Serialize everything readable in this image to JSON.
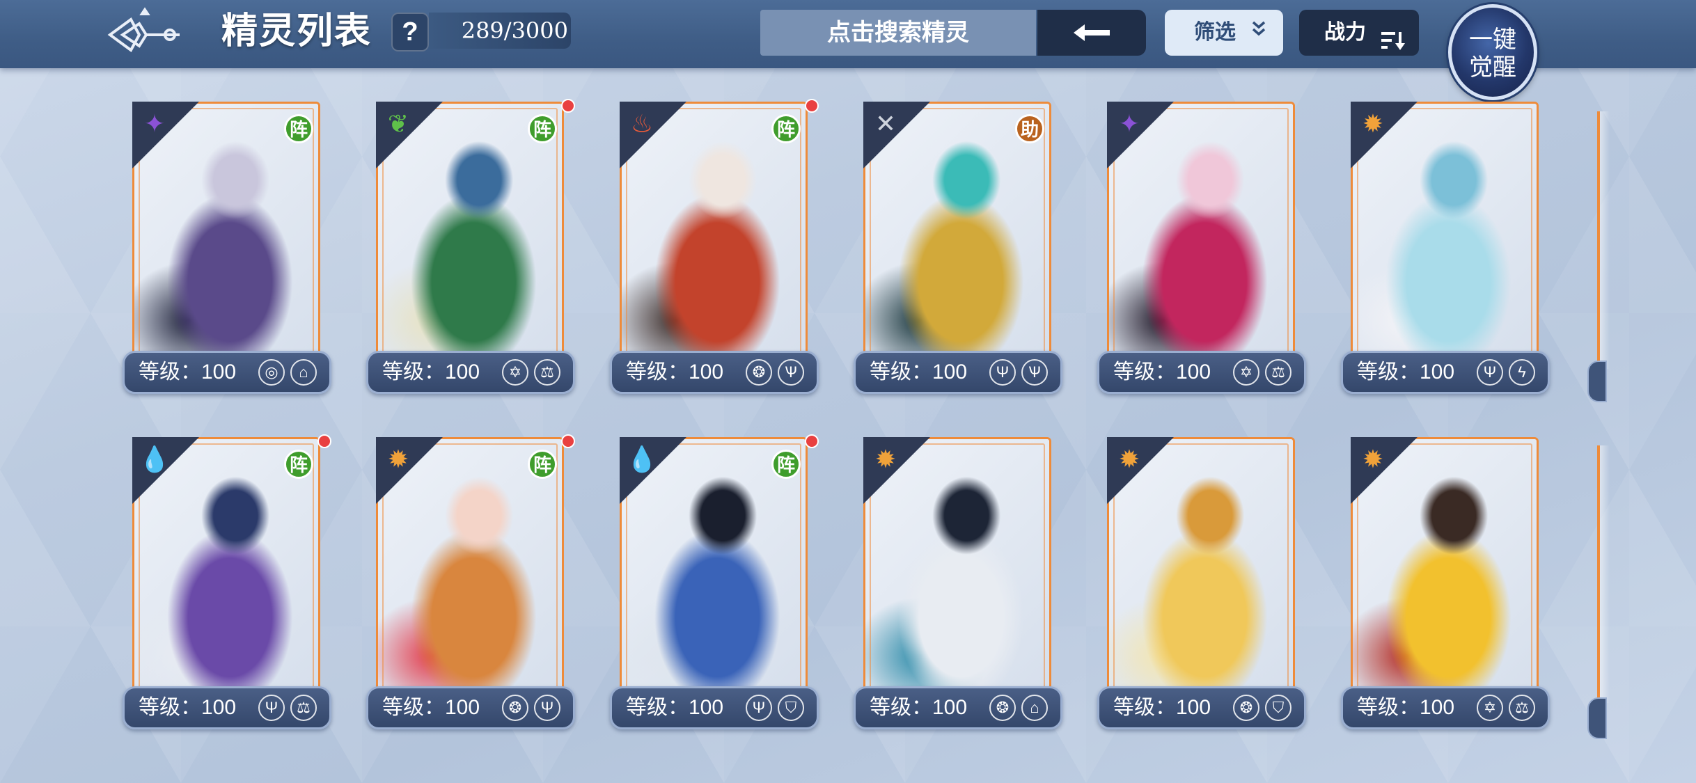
{
  "header": {
    "title": "精灵列表",
    "help": "?",
    "count": "289/3000",
    "search_placeholder": "点击搜索精灵",
    "search_back": "⟵",
    "filter_label": "筛选",
    "sort_label": "战力",
    "awaken_line1": "一键",
    "awaken_line2": "觉醒"
  },
  "colors": {
    "topbar": "#3f5d86",
    "card_border": "#ee8b3a",
    "badge_green": "#3f9d2c",
    "badge_orange": "#b9621e",
    "notify_red": "#e94040"
  },
  "cards": [
    {
      "element": "dark",
      "element_icon": "✦",
      "element_color": "#8b52d6",
      "badge": "阵",
      "badge_type": "green",
      "new": false,
      "level": "等级：100",
      "skills": [
        "swirl",
        "book"
      ],
      "art": [
        "#5a4a8a",
        "#1c1f38",
        "#c9c6dc"
      ]
    },
    {
      "element": "grass",
      "element_icon": "❦",
      "element_color": "#5fc04a",
      "badge": "阵",
      "badge_type": "green",
      "new": true,
      "level": "等级：100",
      "skills": [
        "star",
        "scale"
      ],
      "art": [
        "#2f7a4a",
        "#e8e3c2",
        "#3b6c9c"
      ]
    },
    {
      "element": "fire",
      "element_icon": "♨",
      "element_color": "#e55a3a",
      "badge": "阵",
      "badge_type": "green",
      "new": true,
      "level": "等级：100",
      "skills": [
        "dragon",
        "claw"
      ],
      "art": [
        "#c3432c",
        "#3a2a26",
        "#efe6e0"
      ]
    },
    {
      "element": "neutral",
      "element_icon": "✕",
      "element_color": "#cfd4dd",
      "badge": "助",
      "badge_type": "orange",
      "new": false,
      "level": "等级：100",
      "skills": [
        "trident",
        "claw"
      ],
      "art": [
        "#d2a93a",
        "#17343a",
        "#3bbbb7"
      ]
    },
    {
      "element": "dark",
      "element_icon": "✦",
      "element_color": "#8b52d6",
      "badge": "",
      "badge_type": "",
      "new": false,
      "level": "等级：100",
      "skills": [
        "star",
        "scale"
      ],
      "art": [
        "#c2265e",
        "#1c1424",
        "#f0c7d9"
      ]
    },
    {
      "element": "light",
      "element_icon": "✹",
      "element_color": "#f0a23a",
      "badge": "",
      "badge_type": "",
      "new": false,
      "level": "等级：100",
      "skills": [
        "trident",
        "bolt"
      ],
      "art": [
        "#a9dcea",
        "#f3f3f7",
        "#7cc0d8"
      ]
    },
    {
      "element": "water",
      "element_icon": "💧",
      "element_color": "#3a8de5",
      "badge": "阵",
      "badge_type": "green",
      "new": true,
      "level": "等级：100",
      "skills": [
        "trident",
        "scale"
      ],
      "art": [
        "#6a4aa8",
        "#e8ebf2",
        "#2b3a6a"
      ]
    },
    {
      "element": "light",
      "element_icon": "✹",
      "element_color": "#f0a23a",
      "badge": "阵",
      "badge_type": "green",
      "new": true,
      "level": "等级：100",
      "skills": [
        "dragon",
        "trident"
      ],
      "art": [
        "#d9863e",
        "#e23a4a",
        "#f4d4c8"
      ]
    },
    {
      "element": "water",
      "element_icon": "💧",
      "element_color": "#3a8de5",
      "badge": "阵",
      "badge_type": "green",
      "new": true,
      "level": "等级：100",
      "skills": [
        "trident",
        "shield"
      ],
      "art": [
        "#3a63b8",
        "#dfe6ee",
        "#1a1f2e"
      ]
    },
    {
      "element": "light",
      "element_icon": "✹",
      "element_color": "#f0a23a",
      "badge": "",
      "badge_type": "",
      "new": false,
      "level": "等级：100",
      "skills": [
        "dragon",
        "book"
      ],
      "art": [
        "#e8ecf2",
        "#2a8aa8",
        "#1d2536"
      ]
    },
    {
      "element": "light",
      "element_icon": "✹",
      "element_color": "#f0a23a",
      "badge": "",
      "badge_type": "",
      "new": false,
      "level": "等级：100",
      "skills": [
        "dragon",
        "shield"
      ],
      "art": [
        "#f0c85a",
        "#f4e6b0",
        "#d99a3a"
      ]
    },
    {
      "element": "light",
      "element_icon": "✹",
      "element_color": "#f0a23a",
      "badge": "",
      "badge_type": "",
      "new": false,
      "level": "等级：100",
      "skills": [
        "star",
        "scale"
      ],
      "art": [
        "#f2c12e",
        "#b3281f",
        "#3a2a24"
      ]
    }
  ]
}
